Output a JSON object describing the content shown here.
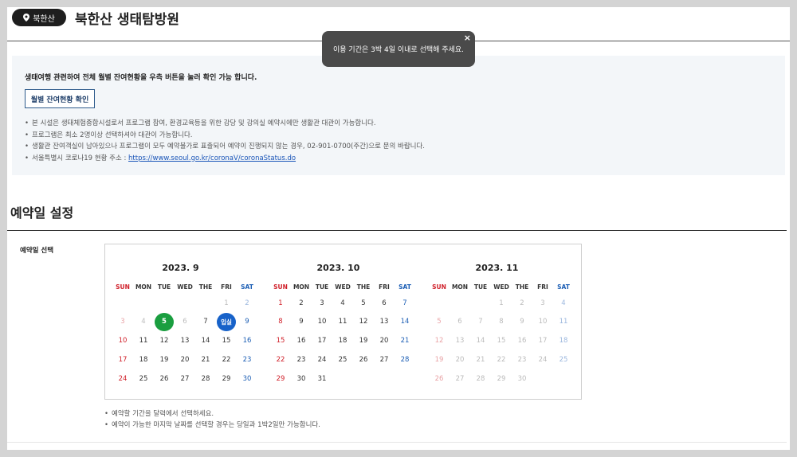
{
  "header": {
    "location": "북한산",
    "title": "북한산 생태탐방원"
  },
  "toast": {
    "message": "이용 기간은 3박 4일 이내로 선택해 주세요.",
    "close": "×"
  },
  "notice": {
    "heading": "생태여행 관련하여 전체 월별 잔여현황을 우측 버튼을 눌러 확인 가능 합니다.",
    "button": "월별 잔여현황 확인",
    "items": [
      "본 시설은 생태체험종합시설로서 프로그램 참여, 환경교육등을 위한 강당 및 강의실 예약시에만 생활관 대관이 가능합니다.",
      "프로그램은 최소 2명이상 선택하셔야 대관이 가능합니다.",
      "생활관 잔여객실이 남아있으나 프로그램이 모두 예약불가로 표출되어 예약이 진행되지 않는 경우, 02-901-0700(주간)으로 문의 바랍니다."
    ],
    "corona_prefix": "서울특별시 코로나19 현황 주소 : ",
    "corona_link": "https://www.seoul.go.kr/coronaV/coronaStatus.do"
  },
  "reservation": {
    "section_title": "예약일 설정",
    "field_label": "예약일 선택",
    "weekdays": [
      "SUN",
      "MON",
      "TUE",
      "WED",
      "THE",
      "FRI",
      "SAT"
    ],
    "months": [
      {
        "title": "2023. 9",
        "rows": [
          [
            {
              "d": ""
            },
            {
              "d": ""
            },
            {
              "d": ""
            },
            {
              "d": ""
            },
            {
              "d": ""
            },
            {
              "d": "1",
              "dis": true
            },
            {
              "d": "2",
              "dis": true
            }
          ],
          [
            {
              "d": "3",
              "dis": true
            },
            {
              "d": "4",
              "dis": true
            },
            {
              "d": "5",
              "sel": "green"
            },
            {
              "d": "6",
              "dis": true
            },
            {
              "d": "7"
            },
            {
              "d": "입실",
              "sel": "blue"
            },
            {
              "d": "9"
            }
          ],
          [
            {
              "d": "10"
            },
            {
              "d": "11"
            },
            {
              "d": "12"
            },
            {
              "d": "13"
            },
            {
              "d": "14"
            },
            {
              "d": "15"
            },
            {
              "d": "16"
            }
          ],
          [
            {
              "d": "17"
            },
            {
              "d": "18"
            },
            {
              "d": "19"
            },
            {
              "d": "20"
            },
            {
              "d": "21"
            },
            {
              "d": "22"
            },
            {
              "d": "23"
            }
          ],
          [
            {
              "d": "24"
            },
            {
              "d": "25"
            },
            {
              "d": "26"
            },
            {
              "d": "27"
            },
            {
              "d": "28"
            },
            {
              "d": "29"
            },
            {
              "d": "30"
            }
          ]
        ]
      },
      {
        "title": "2023. 10",
        "rows": [
          [
            {
              "d": "1"
            },
            {
              "d": "2"
            },
            {
              "d": "3"
            },
            {
              "d": "4"
            },
            {
              "d": "5"
            },
            {
              "d": "6"
            },
            {
              "d": "7"
            }
          ],
          [
            {
              "d": "8"
            },
            {
              "d": "9"
            },
            {
              "d": "10"
            },
            {
              "d": "11"
            },
            {
              "d": "12"
            },
            {
              "d": "13"
            },
            {
              "d": "14"
            }
          ],
          [
            {
              "d": "15"
            },
            {
              "d": "16"
            },
            {
              "d": "17"
            },
            {
              "d": "18"
            },
            {
              "d": "19"
            },
            {
              "d": "20"
            },
            {
              "d": "21"
            }
          ],
          [
            {
              "d": "22"
            },
            {
              "d": "23"
            },
            {
              "d": "24"
            },
            {
              "d": "25"
            },
            {
              "d": "26"
            },
            {
              "d": "27"
            },
            {
              "d": "28"
            }
          ],
          [
            {
              "d": "29"
            },
            {
              "d": "30"
            },
            {
              "d": "31"
            },
            {
              "d": ""
            },
            {
              "d": ""
            },
            {
              "d": ""
            },
            {
              "d": ""
            }
          ]
        ]
      },
      {
        "title": "2023. 11",
        "rows": [
          [
            {
              "d": ""
            },
            {
              "d": ""
            },
            {
              "d": ""
            },
            {
              "d": "1",
              "dis": true
            },
            {
              "d": "2",
              "dis": true
            },
            {
              "d": "3",
              "dis": true
            },
            {
              "d": "4",
              "dis": true
            }
          ],
          [
            {
              "d": "5",
              "dis": true
            },
            {
              "d": "6",
              "dis": true
            },
            {
              "d": "7",
              "dis": true
            },
            {
              "d": "8",
              "dis": true
            },
            {
              "d": "9",
              "dis": true
            },
            {
              "d": "10",
              "dis": true
            },
            {
              "d": "11",
              "dis": true
            }
          ],
          [
            {
              "d": "12",
              "dis": true
            },
            {
              "d": "13",
              "dis": true
            },
            {
              "d": "14",
              "dis": true
            },
            {
              "d": "15",
              "dis": true
            },
            {
              "d": "16",
              "dis": true
            },
            {
              "d": "17",
              "dis": true
            },
            {
              "d": "18",
              "dis": true
            }
          ],
          [
            {
              "d": "19",
              "dis": true
            },
            {
              "d": "20",
              "dis": true
            },
            {
              "d": "21",
              "dis": true
            },
            {
              "d": "22",
              "dis": true
            },
            {
              "d": "23",
              "dis": true
            },
            {
              "d": "24",
              "dis": true
            },
            {
              "d": "25",
              "dis": true
            }
          ],
          [
            {
              "d": "26",
              "dis": true
            },
            {
              "d": "27",
              "dis": true
            },
            {
              "d": "28",
              "dis": true
            },
            {
              "d": "29",
              "dis": true
            },
            {
              "d": "30",
              "dis": true
            },
            {
              "d": ""
            },
            {
              "d": ""
            }
          ]
        ]
      }
    ],
    "help": [
      "예약할 기간을 달력에서 선택하세요.",
      "예약이 가능한 마지막 날짜를 선택할 경우는 당일과 1박2일만 가능합니다."
    ]
  },
  "colors": {
    "selected_green": "#1a9e3f",
    "selected_blue": "#1762c9",
    "sunday": "#d0202a",
    "saturday": "#1d5fb5"
  }
}
